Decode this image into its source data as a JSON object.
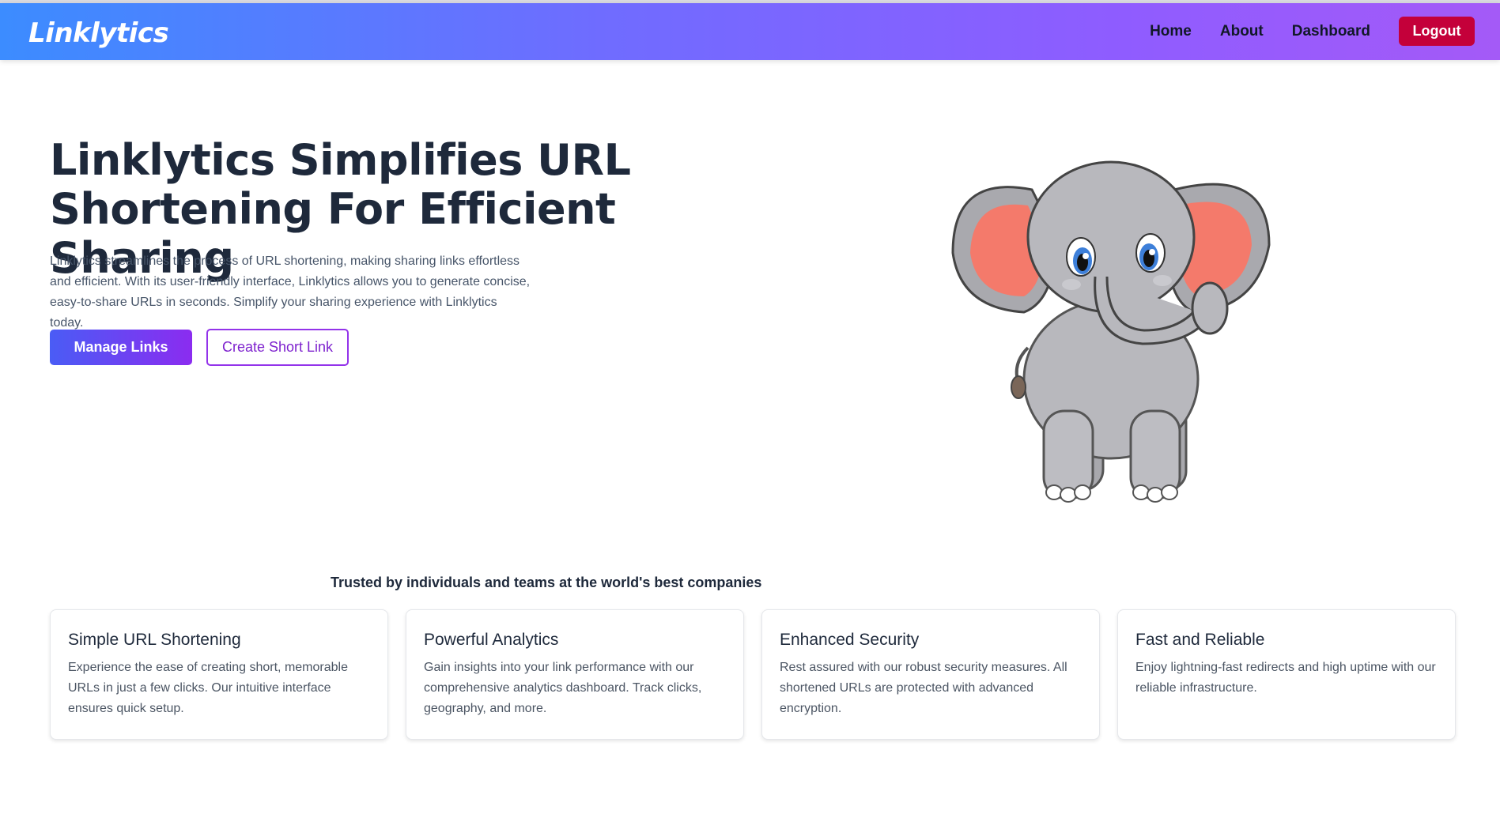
{
  "header": {
    "brand": "Linklytics",
    "nav": [
      "Home",
      "About",
      "Dashboard"
    ],
    "logout_label": "Logout"
  },
  "hero": {
    "title_line1": "Linklytics Simplifies URL",
    "title_line2": "Shortening For Efficient Sharing",
    "description": "Linklytics streamlines the process of URL shortening, making sharing links effortless and efficient. With its user-friendly interface, Linklytics allows you to generate concise, easy-to-share URLs in seconds. Simplify your sharing experience with Linklytics today.",
    "primary_button": "Manage Links",
    "secondary_button": "Create Short Link",
    "image": "elephant-illustration"
  },
  "trusted_text": "Trusted by individuals and teams at the world's best companies",
  "features": [
    {
      "title": "Simple URL Shortening",
      "text": "Experience the ease of creating short, memorable URLs in just a few clicks. Our intuitive interface ensures quick setup."
    },
    {
      "title": "Powerful Analytics",
      "text": "Gain insights into your link performance with our comprehensive analytics dashboard. Track clicks, geography, and more."
    },
    {
      "title": "Enhanced Security",
      "text": "Rest assured with our robust security measures. All shortened URLs are protected with advanced encryption."
    },
    {
      "title": "Fast and Reliable",
      "text": "Enjoy lightning-fast redirects and high uptime with our reliable infrastructure."
    }
  ],
  "colors": {
    "nav_gradient_start": "#3c8cff",
    "nav_gradient_end": "#a45af7",
    "logout": "#c4003a",
    "primary_gradient_start": "#4a5cf5",
    "primary_gradient_end": "#8b2cf0",
    "outline_purple": "#9333ea"
  }
}
